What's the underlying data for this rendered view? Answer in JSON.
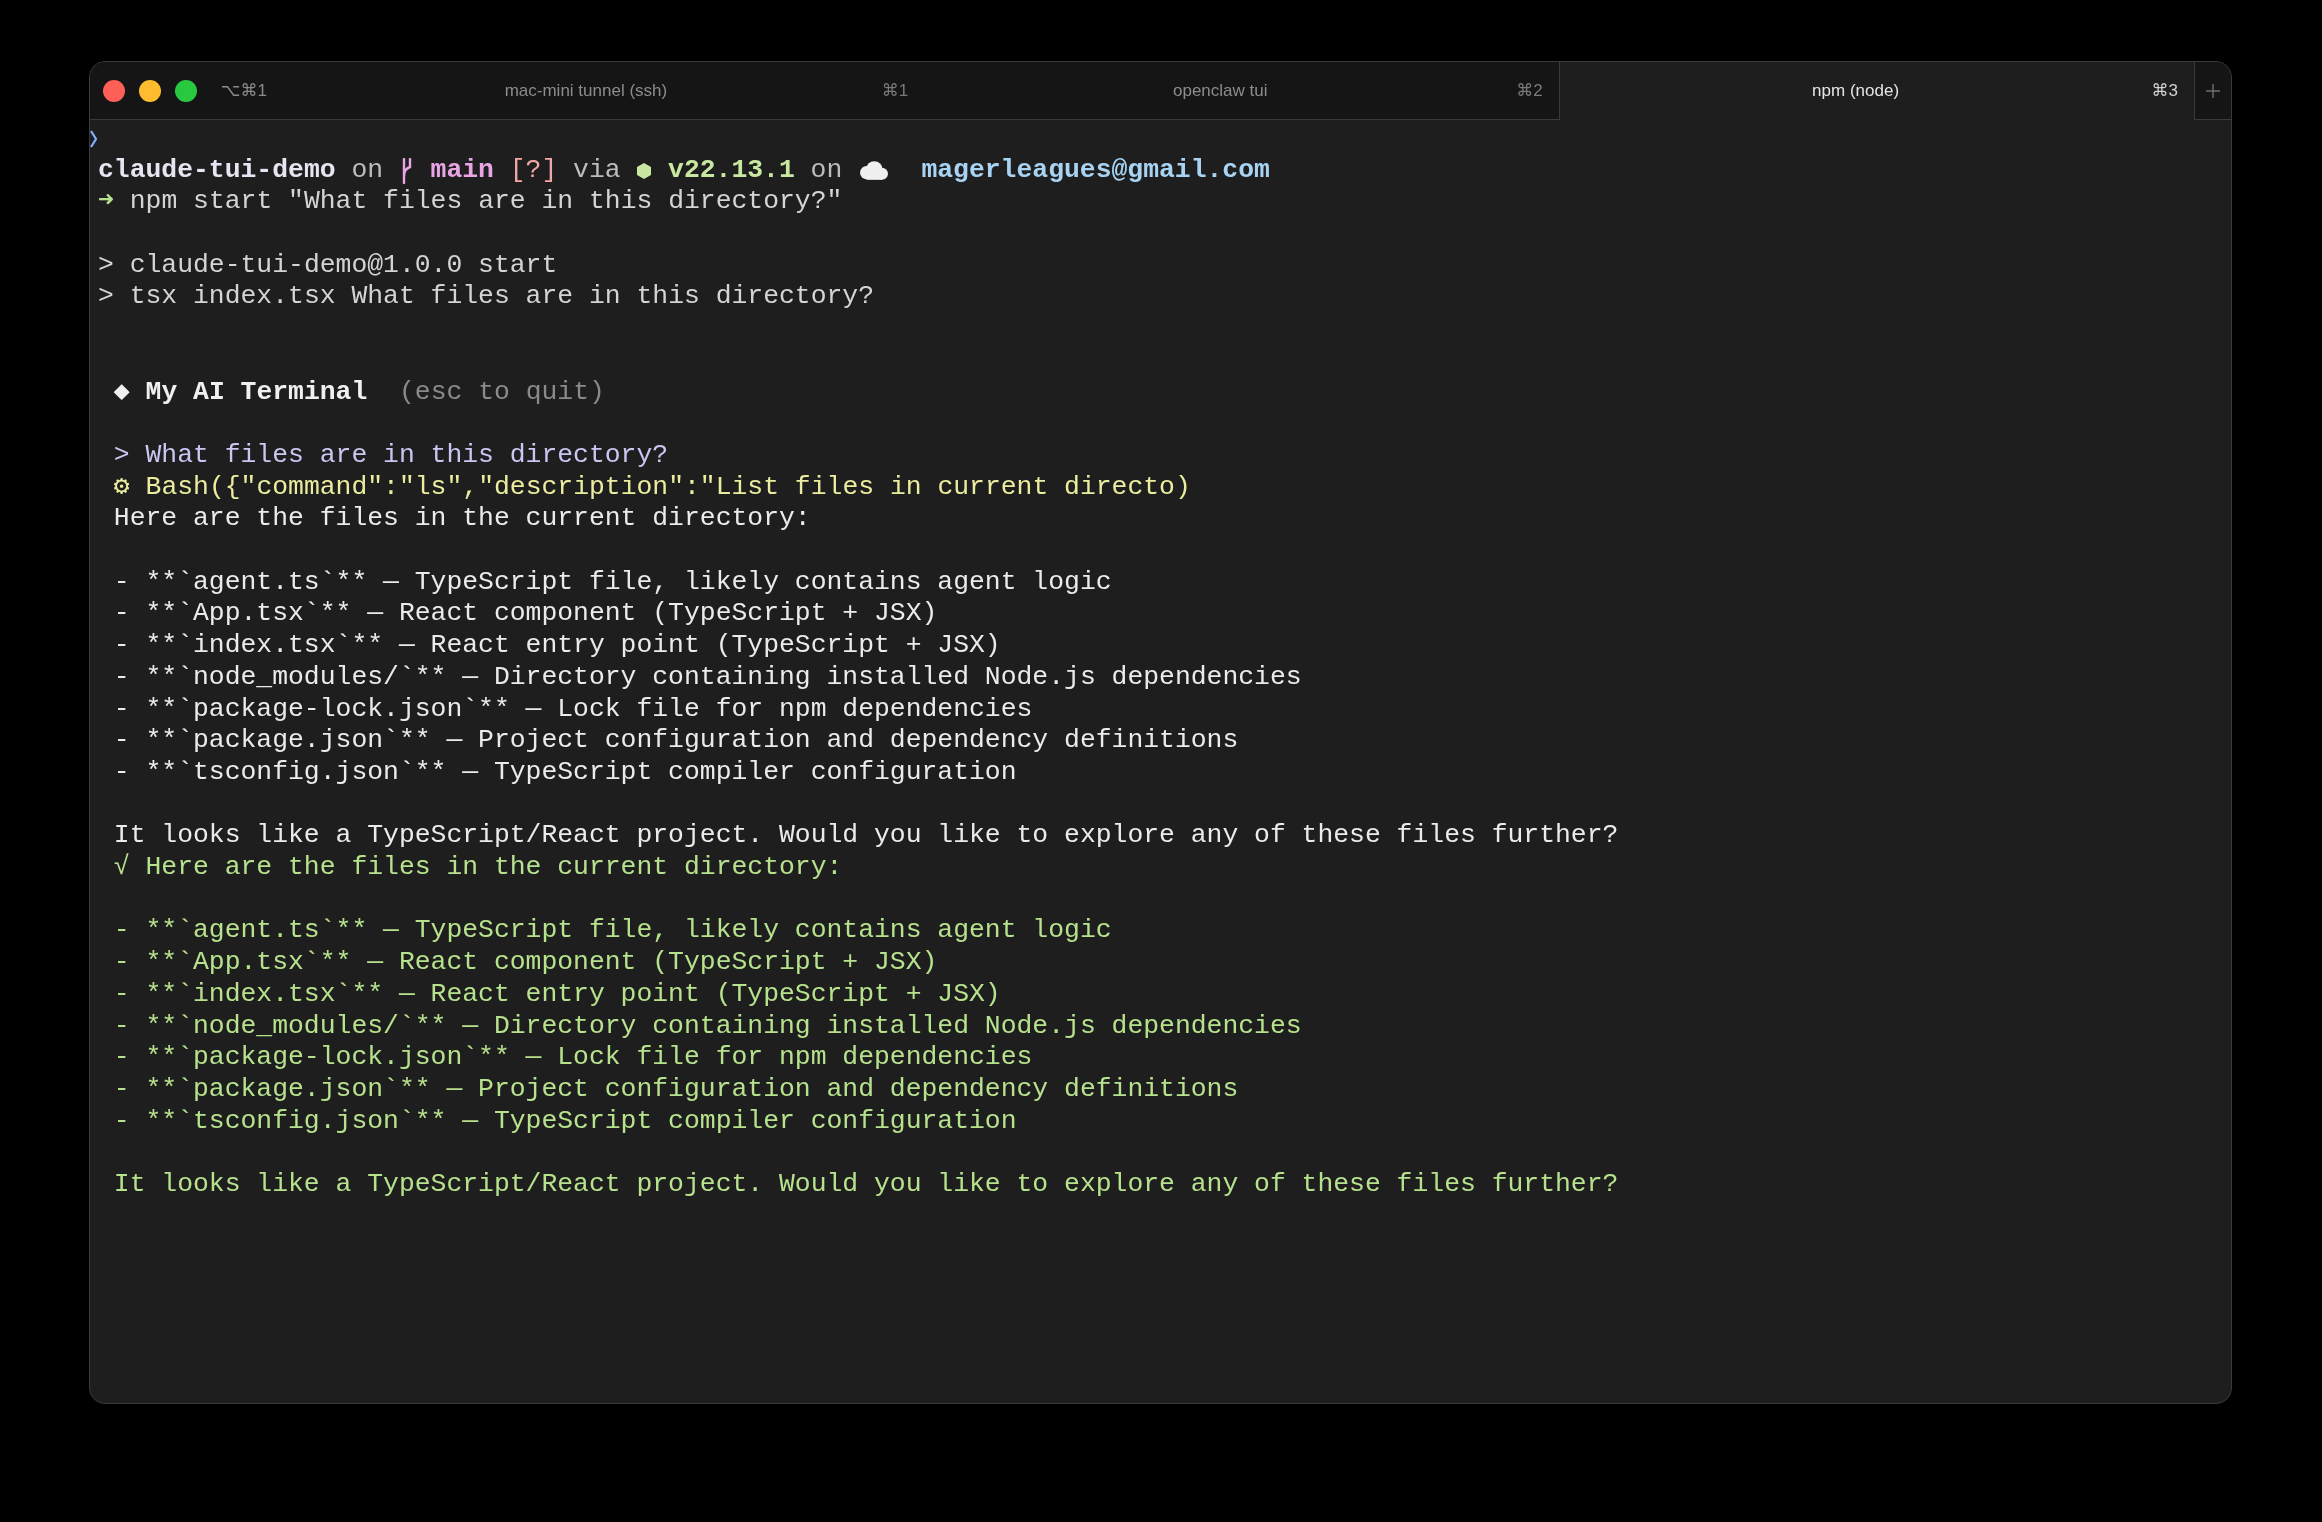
{
  "tab_bar": {
    "window_shortcut": "⌥⌘1",
    "tabs": [
      {
        "title": "mac-mini tunnel (ssh)",
        "shortcut": "⌘1",
        "selected": false
      },
      {
        "title": "openclaw tui",
        "shortcut": "⌘2",
        "selected": false
      },
      {
        "title": "npm (node)",
        "shortcut": "⌘3",
        "selected": true
      }
    ]
  },
  "terminal": {
    "prompt": [
      {
        "kind": "directory",
        "text": "claude-tui-demo"
      },
      {
        "kind": "plain",
        "text": "on"
      },
      {
        "kind": "branch",
        "text": "main"
      },
      {
        "kind": "status",
        "text": "[?]"
      },
      {
        "kind": "plain",
        "text": "via"
      },
      {
        "kind": "node",
        "text": "v22.13.1"
      },
      {
        "kind": "plain",
        "text": "on"
      },
      {
        "kind": "account",
        "text": "magerleagues@gmail.com"
      }
    ],
    "command": {
      "symbol": "➜",
      "text": "npm start \"What files are in this directory?\""
    },
    "script_output": [
      "> claude-tui-demo@1.0.0 start",
      "> tsx index.tsx What files are in this directory?"
    ],
    "app": {
      "title": "◆ My AI Terminal",
      "hint": "(esc to quit)"
    },
    "messages": [
      {
        "kind": "user",
        "paragraphs": [
          [
            "> What files are in this directory?"
          ]
        ]
      },
      {
        "kind": "tool",
        "paragraphs": [
          [
            "⚙ Bash({\"command\":\"ls\",\"description\":\"List files in current directo)"
          ]
        ]
      },
      {
        "kind": "assistant",
        "paragraphs": [
          [
            "Here are the files in the current directory:"
          ],
          [
            "- **`agent.ts`** — TypeScript file, likely contains agent logic",
            "- **`App.tsx`** — React component (TypeScript + JSX)",
            "- **`index.tsx`** — React entry point (TypeScript + JSX)",
            "- **`node_modules/`** — Directory containing installed Node.js dependencies",
            "- **`package-lock.json`** — Lock file for npm dependencies",
            "- **`package.json`** — Project configuration and dependency definitions",
            "- **`tsconfig.json`** — TypeScript compiler configuration"
          ],
          [
            "It looks like a TypeScript/React project. Would you like to explore any of these files further?"
          ]
        ]
      },
      {
        "kind": "result",
        "paragraphs": [
          [
            "√ Here are the files in the current directory:"
          ],
          [
            "- **`agent.ts`** — TypeScript file, likely contains agent logic",
            "- **`App.tsx`** — React component (TypeScript + JSX)",
            "- **`index.tsx`** — React entry point (TypeScript + JSX)",
            "- **`node_modules/`** — Directory containing installed Node.js dependencies",
            "- **`package-lock.json`** — Lock file for npm dependencies",
            "- **`package.json`** — Project configuration and dependency definitions",
            "- **`tsconfig.json`** — TypeScript compiler configuration"
          ],
          [
            "It looks like a TypeScript/React project. Would you like to explore any of these files further?"
          ]
        ]
      }
    ]
  }
}
